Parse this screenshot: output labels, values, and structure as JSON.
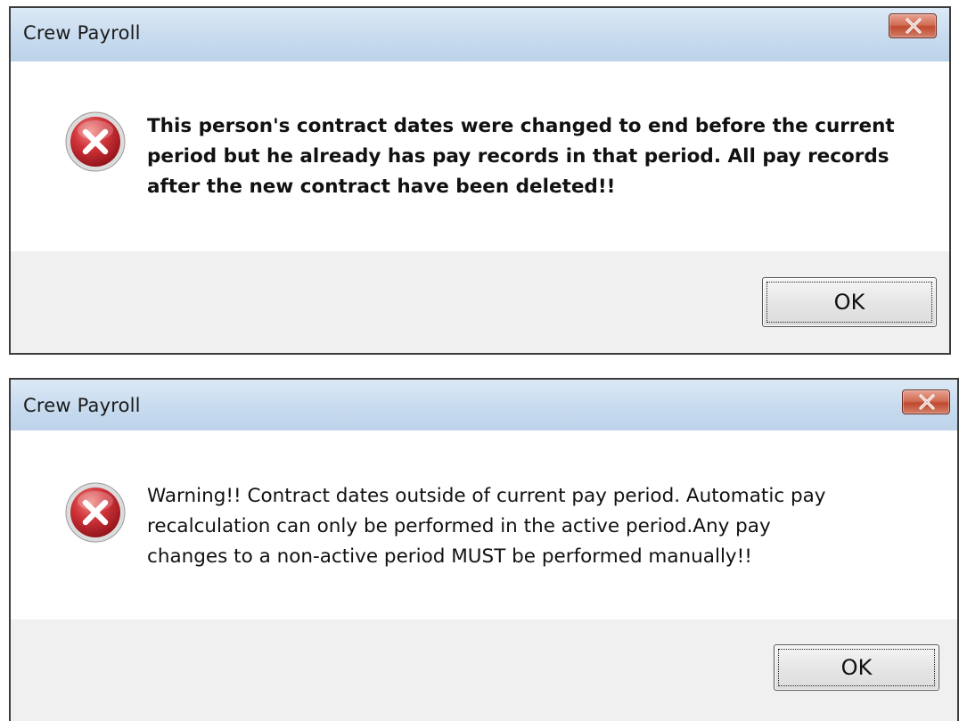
{
  "dialogs": [
    {
      "title": "Crew Payroll",
      "message": "This person's contract dates were changed to end before the current\nperiod but he already has pay records in that period.  All pay records\nafter the new contract have been deleted!!",
      "ok_label": "OK",
      "icon": "error-icon"
    },
    {
      "title": "Crew Payroll",
      "message": "Warning!!  Contract dates outside of current pay period.  Automatic pay\nrecalculation can only be performed in the active period.Any pay\nchanges to a non-active period MUST be performed manually!!",
      "ok_label": "OK",
      "icon": "error-icon"
    }
  ],
  "colors": {
    "titlebar": "#c9dcef",
    "close_button": "#c04a30",
    "footer": "#f0f0f0",
    "error_icon": "#c0262d"
  }
}
